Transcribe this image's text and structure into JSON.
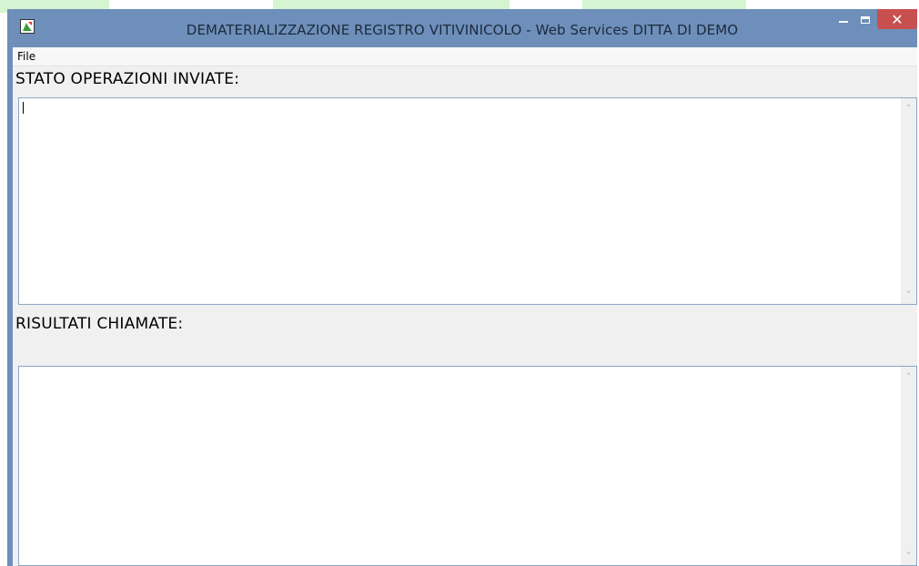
{
  "window": {
    "title": "DEMATERIALIZZAZIONE REGISTRO VITIVINICOLO - Web Services DITTA DI DEMO",
    "controls": {
      "minimize": "–",
      "maximize": "□",
      "close": "✕"
    },
    "icon": "app-icon"
  },
  "menu": {
    "items": [
      {
        "label": "File"
      }
    ]
  },
  "sections": {
    "sent_operations": {
      "label": "STATO OPERAZIONI INVIATE:",
      "value": ""
    },
    "call_results": {
      "label": "RISULTATI CHIAMATE:",
      "value": ""
    }
  },
  "scroll_arrows": {
    "up": "˄",
    "down": "˅"
  },
  "colors": {
    "titlebar": "#6d8fba",
    "close_button": "#c7504f",
    "client": "#f0f0f0"
  }
}
